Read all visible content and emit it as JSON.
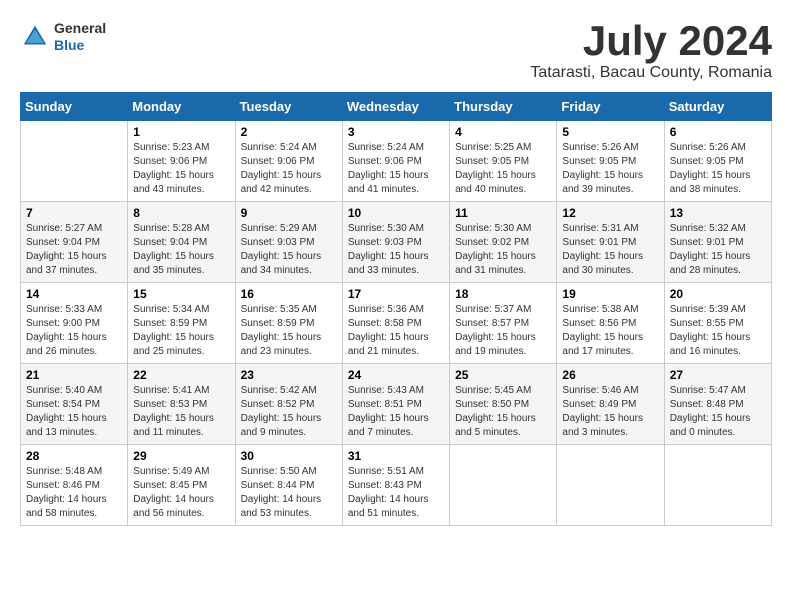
{
  "logo": {
    "general": "General",
    "blue": "Blue"
  },
  "title": {
    "month_year": "July 2024",
    "location": "Tatarasti, Bacau County, Romania"
  },
  "days_of_week": [
    "Sunday",
    "Monday",
    "Tuesday",
    "Wednesday",
    "Thursday",
    "Friday",
    "Saturday"
  ],
  "weeks": [
    [
      {
        "day": "",
        "info": ""
      },
      {
        "day": "1",
        "info": "Sunrise: 5:23 AM\nSunset: 9:06 PM\nDaylight: 15 hours\nand 43 minutes."
      },
      {
        "day": "2",
        "info": "Sunrise: 5:24 AM\nSunset: 9:06 PM\nDaylight: 15 hours\nand 42 minutes."
      },
      {
        "day": "3",
        "info": "Sunrise: 5:24 AM\nSunset: 9:06 PM\nDaylight: 15 hours\nand 41 minutes."
      },
      {
        "day": "4",
        "info": "Sunrise: 5:25 AM\nSunset: 9:05 PM\nDaylight: 15 hours\nand 40 minutes."
      },
      {
        "day": "5",
        "info": "Sunrise: 5:26 AM\nSunset: 9:05 PM\nDaylight: 15 hours\nand 39 minutes."
      },
      {
        "day": "6",
        "info": "Sunrise: 5:26 AM\nSunset: 9:05 PM\nDaylight: 15 hours\nand 38 minutes."
      }
    ],
    [
      {
        "day": "7",
        "info": "Sunrise: 5:27 AM\nSunset: 9:04 PM\nDaylight: 15 hours\nand 37 minutes."
      },
      {
        "day": "8",
        "info": "Sunrise: 5:28 AM\nSunset: 9:04 PM\nDaylight: 15 hours\nand 35 minutes."
      },
      {
        "day": "9",
        "info": "Sunrise: 5:29 AM\nSunset: 9:03 PM\nDaylight: 15 hours\nand 34 minutes."
      },
      {
        "day": "10",
        "info": "Sunrise: 5:30 AM\nSunset: 9:03 PM\nDaylight: 15 hours\nand 33 minutes."
      },
      {
        "day": "11",
        "info": "Sunrise: 5:30 AM\nSunset: 9:02 PM\nDaylight: 15 hours\nand 31 minutes."
      },
      {
        "day": "12",
        "info": "Sunrise: 5:31 AM\nSunset: 9:01 PM\nDaylight: 15 hours\nand 30 minutes."
      },
      {
        "day": "13",
        "info": "Sunrise: 5:32 AM\nSunset: 9:01 PM\nDaylight: 15 hours\nand 28 minutes."
      }
    ],
    [
      {
        "day": "14",
        "info": "Sunrise: 5:33 AM\nSunset: 9:00 PM\nDaylight: 15 hours\nand 26 minutes."
      },
      {
        "day": "15",
        "info": "Sunrise: 5:34 AM\nSunset: 8:59 PM\nDaylight: 15 hours\nand 25 minutes."
      },
      {
        "day": "16",
        "info": "Sunrise: 5:35 AM\nSunset: 8:59 PM\nDaylight: 15 hours\nand 23 minutes."
      },
      {
        "day": "17",
        "info": "Sunrise: 5:36 AM\nSunset: 8:58 PM\nDaylight: 15 hours\nand 21 minutes."
      },
      {
        "day": "18",
        "info": "Sunrise: 5:37 AM\nSunset: 8:57 PM\nDaylight: 15 hours\nand 19 minutes."
      },
      {
        "day": "19",
        "info": "Sunrise: 5:38 AM\nSunset: 8:56 PM\nDaylight: 15 hours\nand 17 minutes."
      },
      {
        "day": "20",
        "info": "Sunrise: 5:39 AM\nSunset: 8:55 PM\nDaylight: 15 hours\nand 16 minutes."
      }
    ],
    [
      {
        "day": "21",
        "info": "Sunrise: 5:40 AM\nSunset: 8:54 PM\nDaylight: 15 hours\nand 13 minutes."
      },
      {
        "day": "22",
        "info": "Sunrise: 5:41 AM\nSunset: 8:53 PM\nDaylight: 15 hours\nand 11 minutes."
      },
      {
        "day": "23",
        "info": "Sunrise: 5:42 AM\nSunset: 8:52 PM\nDaylight: 15 hours\nand 9 minutes."
      },
      {
        "day": "24",
        "info": "Sunrise: 5:43 AM\nSunset: 8:51 PM\nDaylight: 15 hours\nand 7 minutes."
      },
      {
        "day": "25",
        "info": "Sunrise: 5:45 AM\nSunset: 8:50 PM\nDaylight: 15 hours\nand 5 minutes."
      },
      {
        "day": "26",
        "info": "Sunrise: 5:46 AM\nSunset: 8:49 PM\nDaylight: 15 hours\nand 3 minutes."
      },
      {
        "day": "27",
        "info": "Sunrise: 5:47 AM\nSunset: 8:48 PM\nDaylight: 15 hours\nand 0 minutes."
      }
    ],
    [
      {
        "day": "28",
        "info": "Sunrise: 5:48 AM\nSunset: 8:46 PM\nDaylight: 14 hours\nand 58 minutes."
      },
      {
        "day": "29",
        "info": "Sunrise: 5:49 AM\nSunset: 8:45 PM\nDaylight: 14 hours\nand 56 minutes."
      },
      {
        "day": "30",
        "info": "Sunrise: 5:50 AM\nSunset: 8:44 PM\nDaylight: 14 hours\nand 53 minutes."
      },
      {
        "day": "31",
        "info": "Sunrise: 5:51 AM\nSunset: 8:43 PM\nDaylight: 14 hours\nand 51 minutes."
      },
      {
        "day": "",
        "info": ""
      },
      {
        "day": "",
        "info": ""
      },
      {
        "day": "",
        "info": ""
      }
    ]
  ]
}
